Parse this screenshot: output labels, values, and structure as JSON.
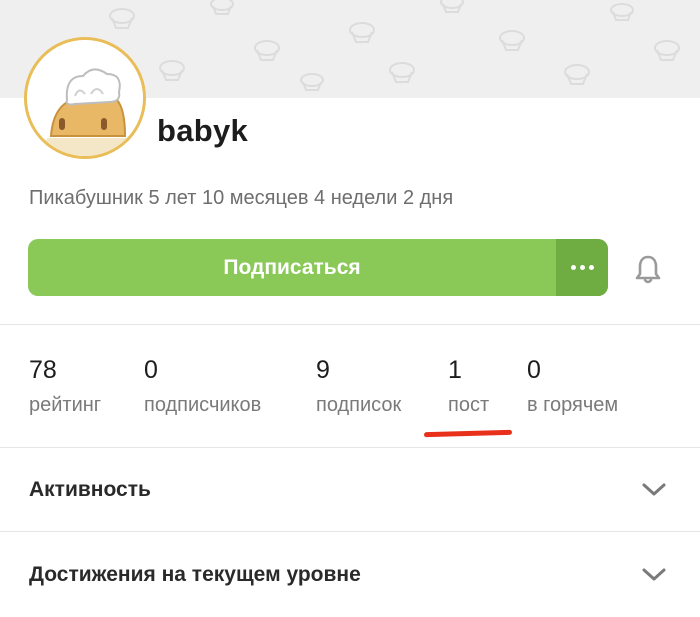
{
  "profile": {
    "username": "babyk",
    "tenure": "Пикабушник 5 лет 10 месяцев 4 недели 2 дня"
  },
  "actions": {
    "subscribe_label": "Подписаться"
  },
  "stats": [
    {
      "value": "78",
      "label": "рейтинг"
    },
    {
      "value": "0",
      "label": "подписчиков"
    },
    {
      "value": "9",
      "label": "подписок"
    },
    {
      "value": "1",
      "label": "пост"
    },
    {
      "value": "0",
      "label": "в горячем"
    }
  ],
  "sections": [
    {
      "title": "Активность"
    },
    {
      "title": "Достижения на текущем уровне"
    }
  ],
  "colors": {
    "subscribe_button": "#8ac858",
    "more_button": "#6fad43",
    "highlight_underline": "#e8301b",
    "avatar_ring": "#e9bd57"
  },
  "icons": {
    "more": "more-dots-icon",
    "bell": "bell-icon",
    "chevron": "chevron-down-icon"
  }
}
